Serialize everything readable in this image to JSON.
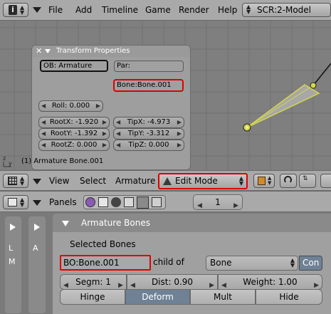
{
  "top_header": {
    "menus": [
      "File",
      "Add",
      "Timeline",
      "Game",
      "Render",
      "Help"
    ],
    "screen": "SCR:2-Model"
  },
  "transform": {
    "title": "Transform Properties",
    "ob": "OB: Armature",
    "par": "Par:",
    "bone": "Bone:Bone.001",
    "roll": "Roll: 0.000",
    "rootx": "RootX: -1.920",
    "rooty": "RootY: -1.392",
    "rootz": "RootZ: 0.000",
    "tipx": "TipX: -4.973",
    "tipy": "TipY: -3.312",
    "tipz": "TipZ: 0.000"
  },
  "viewport": {
    "axis_z": "z",
    "axis_y": "y",
    "status": "(1) Armature Bone.001"
  },
  "view_header": {
    "menus": [
      "View",
      "Select",
      "Armature"
    ],
    "mode": "Edit Mode"
  },
  "buttons_header": {
    "panels": "Panels",
    "frame": "1"
  },
  "side": {
    "l": "L",
    "m": "M",
    "a": "A"
  },
  "armature_panel": {
    "title": "Armature Bones",
    "selected": "Selected Bones",
    "bo": "BO:Bone.001",
    "child_of": "child of",
    "parent": "Bone",
    "con": "Con",
    "segm": "Segm: 1",
    "dist": "Dist: 0.90",
    "weight": "Weight: 1.00",
    "toggles": [
      "Hinge",
      "Deform",
      "Mult",
      "Hide"
    ],
    "deform_active": true
  },
  "colors": {
    "highlight": "#e00000",
    "bone": "#d6d64a",
    "viewport_bg": "#7f7f7f",
    "active_toggle": "#6f8195"
  }
}
